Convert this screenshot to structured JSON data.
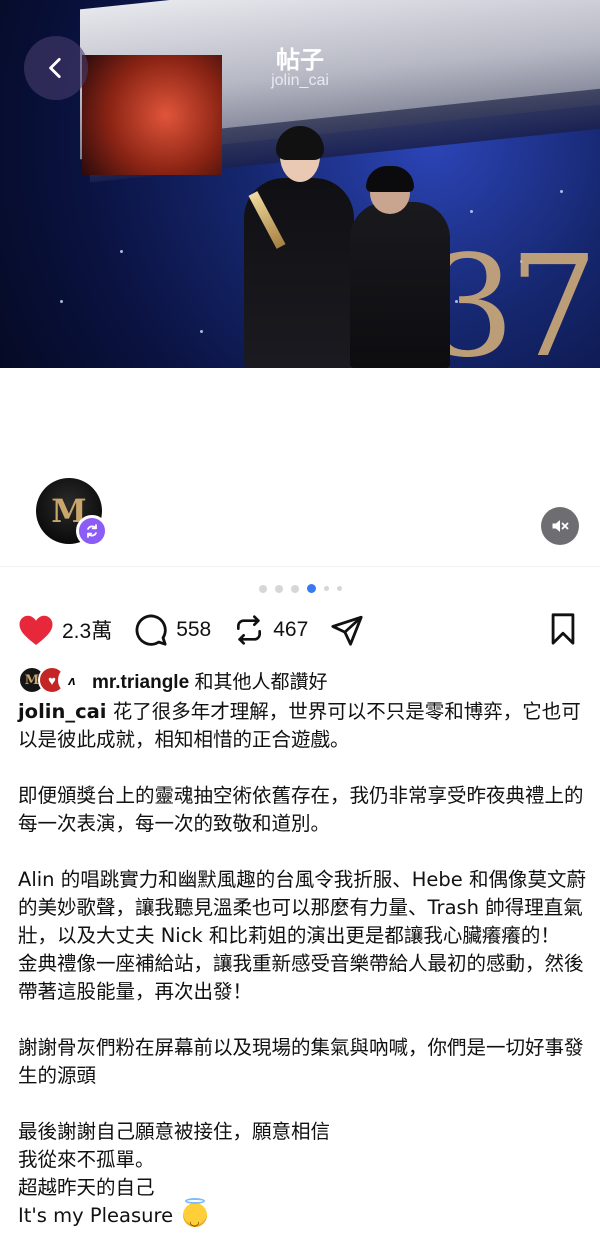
{
  "header": {
    "title": "帖子",
    "subtitle": "jolin_cai"
  },
  "media": {
    "stage_number": "37",
    "carousel": {
      "count": 6,
      "active_index": 3
    }
  },
  "icons": {
    "back": "chevron-left-icon",
    "repost_badge": "repost-icon",
    "mute": "speaker-muted-icon",
    "like": "heart-filled-icon",
    "comment": "comment-bubble-icon",
    "repost": "repost-icon",
    "share": "send-icon",
    "bookmark": "bookmark-icon"
  },
  "colors": {
    "like": "#e6283a",
    "repost_badge": "#8b5cf6",
    "active_dot": "#3a79f0"
  },
  "actions": {
    "likes_count": "2.3萬",
    "comments_count": "558",
    "reposts_count": "467"
  },
  "likes_row": {
    "user": "mr.triangle",
    "suffix": "和其他人都讚好"
  },
  "caption": {
    "author": "jolin_cai",
    "line1": "花了很多年才理解，世界可以不只是零和博弈，它也可以是彼此成就，相知相惜的正合遊戲。",
    "para2": "即便頒獎台上的靈魂抽空術依舊存在，我仍非常享受昨夜典禮上的每一次表演，每一次的致敬和道別。",
    "para3a": "Alin 的唱跳實力和幽默風趣的台風令我折服、Hebe 和偶像莫文蔚的美妙歌聲，讓我聽見溫柔也可以那麼有力量、Trash 帥得理直氣壯，以及大丈夫 Nick 和比莉姐的演出更是都讓我心臟癢癢的！",
    "para3b": "金典禮像一座補給站，讓我重新感受音樂帶給人最初的感動，然後帶著這股能量，再次出發！",
    "para4": "謝謝骨灰們粉在屏幕前以及現場的集氣與吶喊，你們是一切好事發生的源頭",
    "line5a": "最後謝謝自己願意被接住，願意相信",
    "line5b": "我從來不孤單。",
    "line5c": "超越昨天的自己",
    "line5d": "It's my Pleasure"
  }
}
